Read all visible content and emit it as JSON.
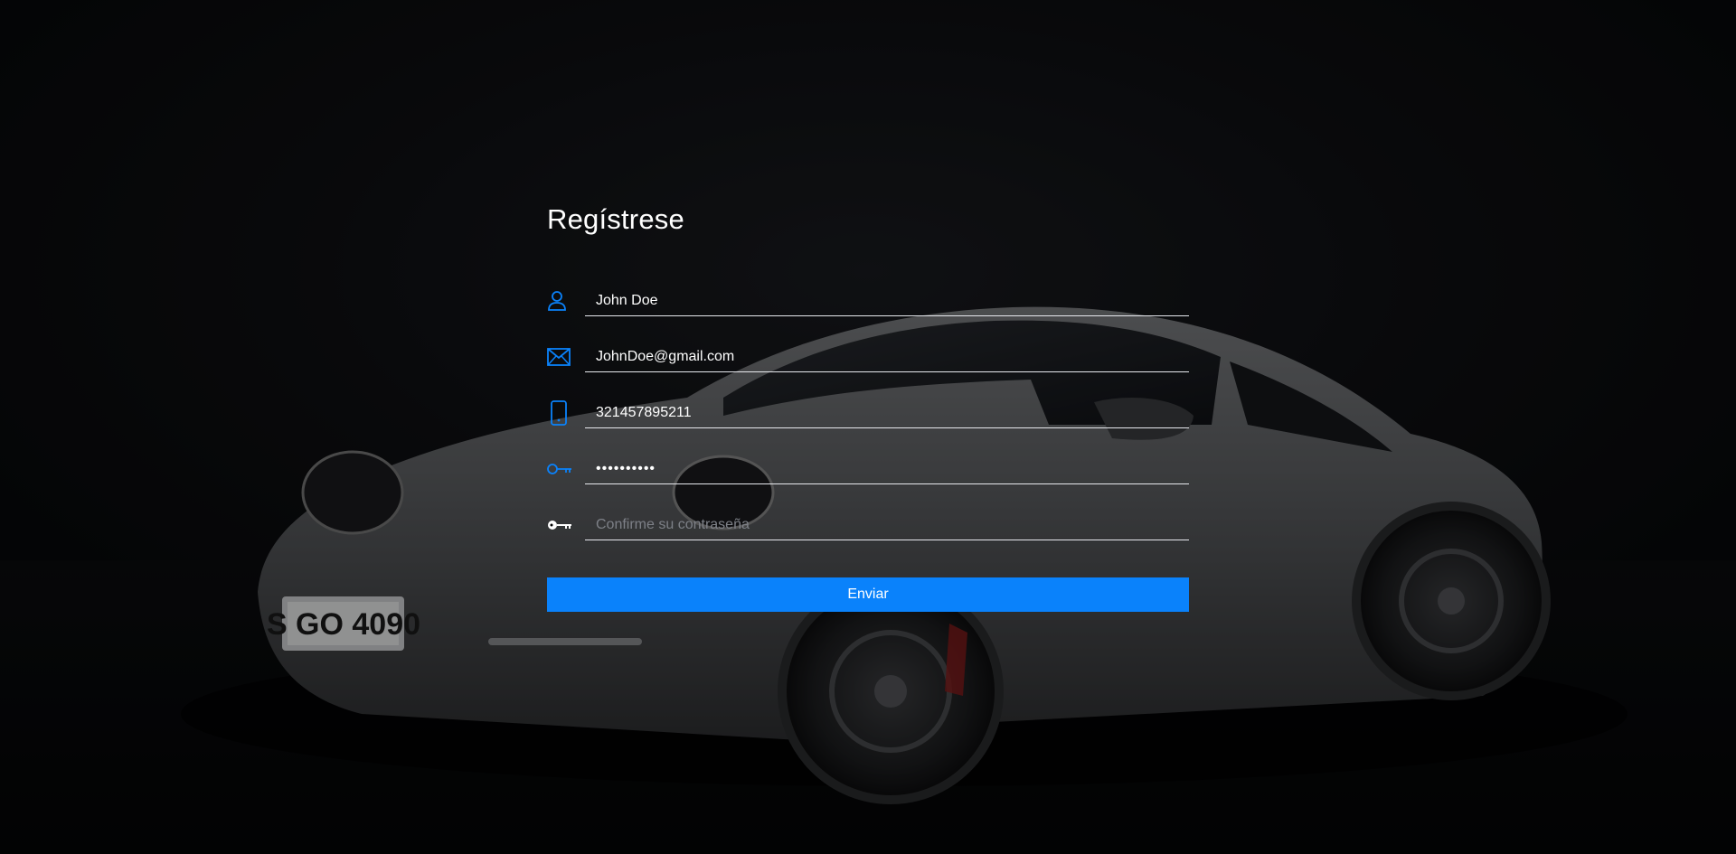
{
  "page": {
    "title": "Regístrese",
    "accent_color": "#0a82fb"
  },
  "form": {
    "fields": [
      {
        "name": "name",
        "icon": "user-icon",
        "value": "John Doe",
        "placeholder": ""
      },
      {
        "name": "email",
        "icon": "envelope-icon",
        "value": "JohnDoe@gmail.com",
        "placeholder": ""
      },
      {
        "name": "phone",
        "icon": "phone-icon",
        "value": "321457895211",
        "placeholder": ""
      },
      {
        "name": "password",
        "icon": "key-outline-icon",
        "value": "••••••••••",
        "placeholder": ""
      },
      {
        "name": "confirm_password",
        "icon": "key-solid-icon",
        "value": "",
        "placeholder": "Confirme su contraseña"
      }
    ],
    "submit_label": "Enviar"
  }
}
